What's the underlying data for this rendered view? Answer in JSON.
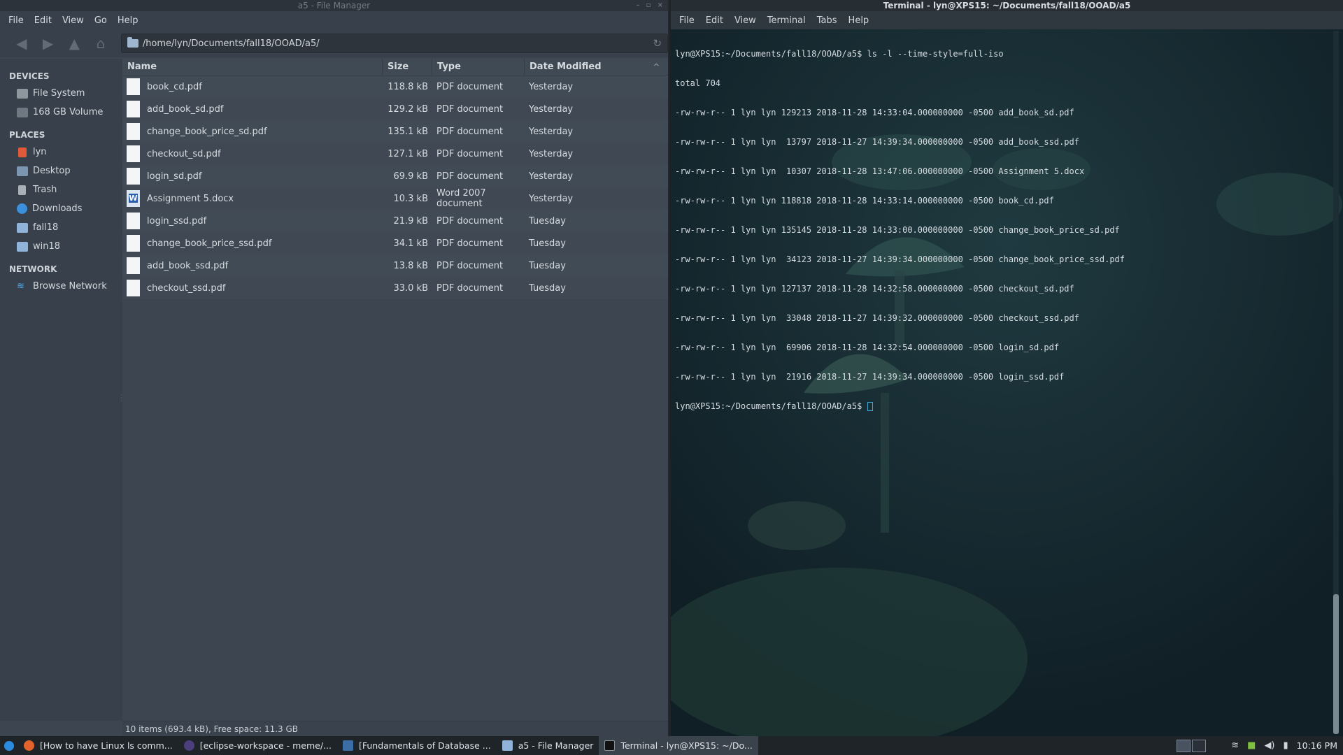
{
  "file_manager": {
    "window_title": "a5 - File Manager",
    "window_controls": "– ▫ ×",
    "menu": [
      "File",
      "Edit",
      "View",
      "Go",
      "Help"
    ],
    "path": "/home/lyn/Documents/fall18/OOAD/a5/",
    "sidebar": {
      "devices_header": "DEVICES",
      "devices": [
        {
          "label": "File System",
          "icon": "drive-icon"
        },
        {
          "label": "168 GB Volume",
          "icon": "drive-icon"
        }
      ],
      "places_header": "PLACES",
      "places": [
        {
          "label": "lyn",
          "icon": "home-icon"
        },
        {
          "label": "Desktop",
          "icon": "desktop-icon"
        },
        {
          "label": "Trash",
          "icon": "trash-icon"
        },
        {
          "label": "Downloads",
          "icon": "download-icon"
        },
        {
          "label": "fall18",
          "icon": "folder-icon"
        },
        {
          "label": "win18",
          "icon": "folder-icon"
        }
      ],
      "network_header": "NETWORK",
      "network": [
        {
          "label": "Browse Network",
          "icon": "network-icon"
        }
      ]
    },
    "columns": {
      "name": "Name",
      "size": "Size",
      "type": "Type",
      "date": "Date Modified",
      "sort_arrow": "^"
    },
    "files": [
      {
        "name": "book_cd.pdf",
        "size": "118.8 kB",
        "type": "PDF document",
        "date": "Yesterday",
        "icon": "pdf-file-icon"
      },
      {
        "name": "add_book_sd.pdf",
        "size": "129.2 kB",
        "type": "PDF document",
        "date": "Yesterday",
        "icon": "pdf-file-icon"
      },
      {
        "name": "change_book_price_sd.pdf",
        "size": "135.1 kB",
        "type": "PDF document",
        "date": "Yesterday",
        "icon": "pdf-file-icon"
      },
      {
        "name": "checkout_sd.pdf",
        "size": "127.1 kB",
        "type": "PDF document",
        "date": "Yesterday",
        "icon": "pdf-file-icon"
      },
      {
        "name": "login_sd.pdf",
        "size": "69.9 kB",
        "type": "PDF document",
        "date": "Yesterday",
        "icon": "pdf-file-icon"
      },
      {
        "name": "Assignment 5.docx",
        "size": "10.3 kB",
        "type": "Word 2007 document",
        "date": "Yesterday",
        "icon": "word-file-icon"
      },
      {
        "name": "login_ssd.pdf",
        "size": "21.9 kB",
        "type": "PDF document",
        "date": "Tuesday",
        "icon": "pdf-file-icon"
      },
      {
        "name": "change_book_price_ssd.pdf",
        "size": "34.1 kB",
        "type": "PDF document",
        "date": "Tuesday",
        "icon": "pdf-file-icon"
      },
      {
        "name": "add_book_ssd.pdf",
        "size": "13.8 kB",
        "type": "PDF document",
        "date": "Tuesday",
        "icon": "pdf-file-icon"
      },
      {
        "name": "checkout_ssd.pdf",
        "size": "33.0 kB",
        "type": "PDF document",
        "date": "Tuesday",
        "icon": "pdf-file-icon"
      }
    ],
    "status": "10 items (693.4 kB), Free space: 11.3 GB"
  },
  "terminal": {
    "window_title": "Terminal - lyn@XPS15: ~/Documents/fall18/OOAD/a5",
    "menu": [
      "File",
      "Edit",
      "View",
      "Terminal",
      "Tabs",
      "Help"
    ],
    "lines": [
      "lyn@XPS15:~/Documents/fall18/OOAD/a5$ ls -l --time-style=full-iso",
      "total 704",
      "-rw-rw-r-- 1 lyn lyn 129213 2018-11-28 14:33:04.000000000 -0500 add_book_sd.pdf",
      "-rw-rw-r-- 1 lyn lyn  13797 2018-11-27 14:39:34.000000000 -0500 add_book_ssd.pdf",
      "-rw-rw-r-- 1 lyn lyn  10307 2018-11-28 13:47:06.000000000 -0500 Assignment 5.docx",
      "-rw-rw-r-- 1 lyn lyn 118818 2018-11-28 14:33:14.000000000 -0500 book_cd.pdf",
      "-rw-rw-r-- 1 lyn lyn 135145 2018-11-28 14:33:00.000000000 -0500 change_book_price_sd.pdf",
      "-rw-rw-r-- 1 lyn lyn  34123 2018-11-27 14:39:34.000000000 -0500 change_book_price_ssd.pdf",
      "-rw-rw-r-- 1 lyn lyn 127137 2018-11-28 14:32:58.000000000 -0500 checkout_sd.pdf",
      "-rw-rw-r-- 1 lyn lyn  33048 2018-11-27 14:39:32.000000000 -0500 checkout_ssd.pdf",
      "-rw-rw-r-- 1 lyn lyn  69906 2018-11-28 14:32:54.000000000 -0500 login_sd.pdf",
      "-rw-rw-r-- 1 lyn lyn  21916 2018-11-27 14:39:34.000000000 -0500 login_ssd.pdf"
    ],
    "prompt": "lyn@XPS15:~/Documents/fall18/OOAD/a5$ "
  },
  "taskbar": {
    "tasks": [
      {
        "label": "[How to have Linux ls comm...",
        "icon": "firefox-icon",
        "active": false
      },
      {
        "label": "[eclipse-workspace - meme/...",
        "icon": "eclipse-icon",
        "active": false
      },
      {
        "label": "[Fundamentals of Database ...",
        "icon": "document-viewer-icon",
        "active": false
      },
      {
        "label": "a5 - File Manager",
        "icon": "folder-icon",
        "active": false
      },
      {
        "label": "Terminal - lyn@XPS15: ~/Do...",
        "icon": "terminal-icon",
        "active": true
      }
    ],
    "clock": "10:16 PM"
  },
  "colors": {
    "file_manager_bg": "#3c4550",
    "sidebar_bg": "#38414b",
    "terminal_bg": "#14252c",
    "accent": "#2b8be0"
  }
}
